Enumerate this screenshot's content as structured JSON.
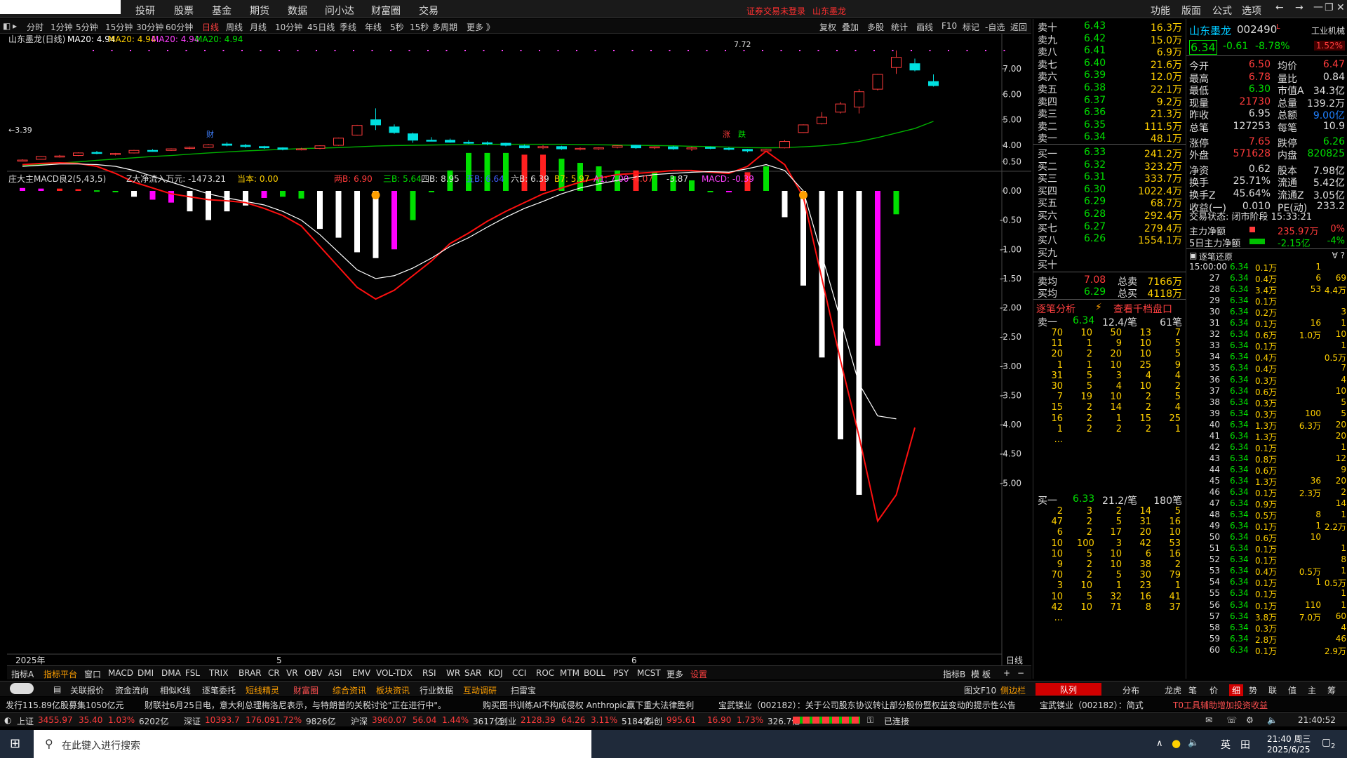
{
  "topmenu": {
    "items": [
      "投研",
      "股票",
      "基金",
      "期货",
      "数据",
      "问小达",
      "财富圈",
      "交易"
    ],
    "notice": "证券交易未登录",
    "stock_name": "山东墨龙",
    "right": [
      "功能",
      "版面",
      "公式",
      "选项"
    ]
  },
  "periods": [
    "分时",
    "1分钟",
    "5分钟",
    "15分钟",
    "30分钟",
    "60分钟",
    "日线",
    "周线",
    "月线",
    "10分钟",
    "45日线",
    "季线",
    "年线",
    "5秒",
    "15秒",
    "多周期",
    "更多 》"
  ],
  "period_active": "日线",
  "tools": [
    "复权",
    "叠加",
    "多股",
    "统计",
    "画线",
    "F10",
    "标记",
    "-自选",
    "返回"
  ],
  "main_chart": {
    "title": "山东墨龙(日线)",
    "ma_labels": [
      "MA20: 4.94",
      "MA20: 4.94",
      "MA20: 4.94",
      "MA20: 4.94"
    ],
    "high_label": "7.72",
    "low_label": "←3.39",
    "axis": [
      "7.00",
      "6.00",
      "5.00",
      "4.00"
    ],
    "badges": [
      "财",
      "涨",
      "跌"
    ]
  },
  "macd": {
    "title": "庄大主MACD良2(5,43,5)",
    "labels": [
      "Z大净流入万元: -1473.21",
      "当本: 0.00",
      "两B: 6.90",
      "三B: 5.64",
      "四B: 8.95",
      "五B: 6.64",
      "六B: 6.39",
      "B7: 5.97",
      "A1: 7.00",
      "-4.07",
      "-3.87",
      "MACD: -0.39"
    ],
    "axis": [
      "0.50",
      "0.00",
      "-0.50",
      "-1.00",
      "-1.50",
      "-2.00",
      "-2.50",
      "-3.00",
      "-3.50",
      "-4.00",
      "-4.50",
      "-5.00"
    ]
  },
  "xaxis": {
    "year": "2025年",
    "months": [
      "5",
      "6"
    ],
    "right": "日线"
  },
  "indicator_tabs": [
    "指标A",
    "指标平台",
    "窗口",
    "MACD",
    "DMI",
    "DMA",
    "FSL",
    "TRIX",
    "BRAR",
    "CR",
    "VR",
    "OBV",
    "ASI",
    "EMV",
    "VOL-TDX",
    "RSI",
    "WR",
    "SAR",
    "KDJ",
    "CCI",
    "ROC",
    "MTM",
    "BOLL",
    "PSY",
    "MCST",
    "更多",
    "设置"
  ],
  "indicator_right": [
    "指标B",
    "模",
    "板",
    "+",
    "−"
  ],
  "bottom_tabs": [
    "关联报价",
    "资金流向",
    "相似K线",
    "逐笔委托",
    "短线精灵",
    "财富圈",
    "综合资讯",
    "板块资讯",
    "行业数据",
    "互动调研",
    "扫雷宝"
  ],
  "bottom_right": [
    "图文F10",
    "侧边栏"
  ],
  "panel_tabs": [
    "队列",
    "分布",
    "龙虎"
  ],
  "right_tabs": [
    "笔",
    "价",
    "细",
    "势",
    "联",
    "值",
    "主",
    "筹"
  ],
  "news": [
    "发行115.89亿股募集1050亿元",
    "财联社6月25日电，意大利总理梅洛尼表示，与特朗普的关税讨论\"正在进行中\"。",
    "购买图书训练AI不构成侵权 Anthropic赢下重大法律胜利",
    "宝武镁业（002182）：关于公司股东协议转让部分股份暨权益变动的提示性公告",
    "宝武镁业（002182）：简式",
    "T0工具辅助增加投资收益"
  ],
  "index_bar": [
    {
      "n": "上证",
      "v": "3455.97",
      "c": "35.40",
      "p": "1.03%",
      "a": "6202亿"
    },
    {
      "n": "深证",
      "v": "10393.7",
      "c": "176.09",
      "p": "1.72%",
      "a": "9826亿"
    },
    {
      "n": "沪深",
      "v": "3960.07",
      "c": "56.04",
      "p": "1.44%",
      "a": "3617亿"
    },
    {
      "n": "创业",
      "v": "2128.39",
      "c": "64.26",
      "p": "3.11%",
      "a": "5184亿"
    },
    {
      "n": "科创",
      "v": "995.61",
      "c": "16.90",
      "p": "1.73%",
      "a": "326.7亿"
    }
  ],
  "connection": "已连接",
  "clock": "21:40:52",
  "orderbook": {
    "asks": [
      [
        "卖十",
        "6.43",
        "16.3万"
      ],
      [
        "卖九",
        "6.42",
        "15.0万"
      ],
      [
        "卖八",
        "6.41",
        "6.9万"
      ],
      [
        "卖七",
        "6.40",
        "21.6万"
      ],
      [
        "卖六",
        "6.39",
        "12.0万"
      ],
      [
        "卖五",
        "6.38",
        "22.1万"
      ],
      [
        "卖四",
        "6.37",
        "9.2万"
      ],
      [
        "卖三",
        "6.36",
        "21.3万"
      ],
      [
        "卖二",
        "6.35",
        "111.5万"
      ],
      [
        "卖一",
        "6.34",
        "48.1万"
      ]
    ],
    "bids": [
      [
        "买一",
        "6.33",
        "241.2万"
      ],
      [
        "买二",
        "6.32",
        "323.2万"
      ],
      [
        "买三",
        "6.31",
        "333.7万"
      ],
      [
        "买四",
        "6.30",
        "1022.4万"
      ],
      [
        "买五",
        "6.29",
        "68.7万"
      ],
      [
        "买六",
        "6.28",
        "292.4万"
      ],
      [
        "买七",
        "6.27",
        "279.4万"
      ],
      [
        "买八",
        "6.26",
        "1554.1万"
      ],
      [
        "买九",
        "",
        ""
      ],
      [
        "买十",
        "",
        ""
      ]
    ],
    "avg_sell": [
      "卖均",
      "7.08",
      "总卖",
      "7166万"
    ],
    "avg_buy": [
      "买均",
      "6.29",
      "总买",
      "4118万"
    ],
    "analysis": "逐笔分析",
    "view_1000": "查看千档盘口",
    "sell1_head": [
      "卖一",
      "6.34",
      "12.4/笔",
      "61笔"
    ],
    "sell1_queue": [
      [
        "70",
        "10",
        "50",
        "13",
        "7"
      ],
      [
        "11",
        "1",
        "9",
        "10",
        "5"
      ],
      [
        "20",
        "2",
        "20",
        "10",
        "5"
      ],
      [
        "1",
        "1",
        "10",
        "25",
        "9"
      ],
      [
        "31",
        "5",
        "3",
        "4",
        "4"
      ],
      [
        "30",
        "5",
        "4",
        "10",
        "2"
      ],
      [
        "7",
        "19",
        "10",
        "2",
        "5"
      ],
      [
        "15",
        "2",
        "14",
        "2",
        "4"
      ],
      [
        "16",
        "2",
        "1",
        "15",
        "25"
      ],
      [
        "1",
        "2",
        "2",
        "2",
        "1"
      ],
      [
        "...",
        "",
        "",
        "",
        ""
      ]
    ],
    "buy1_head": [
      "买一",
      "6.33",
      "21.2/笔",
      "180笔"
    ],
    "buy1_queue": [
      [
        "2",
        "3",
        "2",
        "14",
        "5"
      ],
      [
        "47",
        "2",
        "5",
        "31",
        "16"
      ],
      [
        "6",
        "2",
        "17",
        "20",
        "10"
      ],
      [
        "10",
        "100",
        "3",
        "42",
        "53"
      ],
      [
        "10",
        "5",
        "10",
        "6",
        "16"
      ],
      [
        "9",
        "2",
        "10",
        "38",
        "2"
      ],
      [
        "70",
        "2",
        "5",
        "30",
        "79"
      ],
      [
        "3",
        "10",
        "1",
        "23",
        "1"
      ],
      [
        "10",
        "5",
        "32",
        "16",
        "41"
      ],
      [
        "42",
        "10",
        "71",
        "8",
        "37"
      ],
      [
        "...",
        "",
        "",
        "",
        ""
      ]
    ]
  },
  "quote": {
    "name": "山东墨龙",
    "code": "002490",
    "sector": "工业机械",
    "price": "6.34",
    "chg": "-0.61",
    "pct": "-8.78%",
    "side": "1.52%",
    "rows": [
      [
        "今开",
        "6.50",
        "均价",
        "6.47"
      ],
      [
        "最高",
        "6.78",
        "量比",
        "0.84"
      ],
      [
        "最低",
        "6.30",
        "市值A",
        "34.3亿"
      ],
      [
        "现量",
        "21730",
        "总量",
        "139.2万"
      ],
      [
        "昨收",
        "6.95",
        "总额",
        "9.00亿"
      ],
      [
        "总笔",
        "127253",
        "每笔",
        "10.9"
      ],
      [
        "涨停",
        "7.65",
        "跌停",
        "6.26"
      ],
      [
        "外盘",
        "571628",
        "内盘",
        "820825"
      ],
      [
        "净资",
        "0.62",
        "股本",
        "7.98亿"
      ],
      [
        "换手",
        "25.71%",
        "流通",
        "5.42亿"
      ],
      [
        "换手Z",
        "45.64%",
        "流通Z",
        "3.05亿"
      ],
      [
        "收益(一)",
        "0.010",
        "PE(动)",
        "233.2"
      ]
    ],
    "status": "交易状态: 闭市阶段 15:33:21",
    "flow1": [
      "主力净额",
      "235.97万",
      "0%"
    ],
    "flow2": [
      "5日主力净额",
      "-2.15亿",
      "-4%"
    ],
    "ticks_title": "逐笔还原",
    "ticks": [
      [
        "15:00:00",
        "6.34",
        "0.1万",
        "1",
        ""
      ],
      [
        "27",
        "6.34",
        "0.4万",
        "6",
        "69"
      ],
      [
        "28",
        "6.34",
        "3.4万",
        "53",
        "4.4万"
      ],
      [
        "29",
        "6.34",
        "0.1万",
        "",
        ""
      ],
      [
        "30",
        "6.34",
        "0.2万",
        "",
        "3"
      ],
      [
        "31",
        "6.34",
        "0.1万",
        "16",
        "1"
      ],
      [
        "32",
        "6.34",
        "0.6万",
        "1.0万",
        "10"
      ],
      [
        "33",
        "6.34",
        "0.1万",
        "",
        "1"
      ],
      [
        "34",
        "6.34",
        "0.4万",
        "",
        "0.5万"
      ],
      [
        "35",
        "6.34",
        "0.4万",
        "",
        "7"
      ],
      [
        "36",
        "6.34",
        "0.3万",
        "",
        "4"
      ],
      [
        "37",
        "6.34",
        "0.6万",
        "",
        "10"
      ],
      [
        "38",
        "6.34",
        "0.3万",
        "",
        "5"
      ],
      [
        "39",
        "6.34",
        "0.3万",
        "100",
        "5"
      ],
      [
        "40",
        "6.34",
        "1.3万",
        "6.3万",
        "20"
      ],
      [
        "41",
        "6.34",
        "1.3万",
        "",
        "20"
      ],
      [
        "42",
        "6.34",
        "0.1万",
        "",
        "1"
      ],
      [
        "43",
        "6.34",
        "0.8万",
        "",
        "12"
      ],
      [
        "44",
        "6.34",
        "0.6万",
        "",
        "9"
      ],
      [
        "45",
        "6.34",
        "1.3万",
        "36",
        "20"
      ],
      [
        "46",
        "6.34",
        "0.1万",
        "2.3万",
        "2"
      ],
      [
        "47",
        "6.34",
        "0.9万",
        "",
        "14"
      ],
      [
        "48",
        "6.34",
        "0.5万",
        "8",
        "1"
      ],
      [
        "49",
        "6.34",
        "0.1万",
        "1",
        "2.2万"
      ],
      [
        "50",
        "6.34",
        "0.6万",
        "10",
        ""
      ],
      [
        "51",
        "6.34",
        "0.1万",
        "",
        "1"
      ],
      [
        "52",
        "6.34",
        "0.1万",
        "",
        "8"
      ],
      [
        "53",
        "6.34",
        "0.4万",
        "0.5万",
        "1"
      ],
      [
        "54",
        "6.34",
        "0.1万",
        "1",
        "0.5万"
      ],
      [
        "55",
        "6.34",
        "0.1万",
        "",
        "1"
      ],
      [
        "56",
        "6.34",
        "0.1万",
        "110",
        "1"
      ],
      [
        "57",
        "6.34",
        "3.8万",
        "7.0万",
        "60"
      ],
      [
        "58",
        "6.34",
        "0.3万",
        "",
        "4"
      ],
      [
        "59",
        "6.34",
        "2.8万",
        "",
        "46"
      ],
      [
        "60",
        "6.34",
        "0.1万",
        "",
        "2.9万"
      ]
    ]
  },
  "taskbar": {
    "search": "在此键入进行搜索",
    "time": "21:40 周三",
    "date": "2025/6/25",
    "lang": "英",
    "notif": "2"
  },
  "colors": {
    "up": "#ff3b3b",
    "down": "#00e000",
    "ma": "#00b000",
    "white": "#ffffff",
    "magenta": "#ff00ff"
  },
  "chart_data": {
    "type": "candlestick+bar",
    "ohlc": [
      [
        3.39,
        3.45,
        3.38,
        3.42
      ],
      [
        3.45,
        3.58,
        3.44,
        3.56
      ],
      [
        3.55,
        3.62,
        3.52,
        3.58
      ],
      [
        3.6,
        3.72,
        3.58,
        3.7
      ],
      [
        3.72,
        3.78,
        3.65,
        3.68
      ],
      [
        3.66,
        3.7,
        3.6,
        3.68
      ],
      [
        3.7,
        3.82,
        3.68,
        3.8
      ],
      [
        3.8,
        3.85,
        3.75,
        3.78
      ],
      [
        3.8,
        3.88,
        3.78,
        3.86
      ],
      [
        3.88,
        3.95,
        3.85,
        3.92
      ],
      [
        3.92,
        4.05,
        3.9,
        4.02
      ],
      [
        4.05,
        4.12,
        3.96,
        4.0
      ],
      [
        4.0,
        4.05,
        3.9,
        3.95
      ],
      [
        3.95,
        3.98,
        3.86,
        3.9
      ],
      [
        3.9,
        3.92,
        3.8,
        3.84
      ],
      [
        3.84,
        3.9,
        3.8,
        3.86
      ],
      [
        3.88,
        4.0,
        3.85,
        3.98
      ],
      [
        4.0,
        4.3,
        3.98,
        4.28
      ],
      [
        4.4,
        4.8,
        4.38,
        4.78
      ],
      [
        5.0,
        5.45,
        4.6,
        4.8
      ],
      [
        4.72,
        4.82,
        4.45,
        4.5
      ],
      [
        4.45,
        4.5,
        4.1,
        4.2
      ],
      [
        4.2,
        4.32,
        4.15,
        4.18
      ],
      [
        4.2,
        4.26,
        4.1,
        4.12
      ],
      [
        4.12,
        4.2,
        4.05,
        4.1
      ],
      [
        4.1,
        4.15,
        4.0,
        4.06
      ],
      [
        4.08,
        4.1,
        3.96,
        4.0
      ],
      [
        3.98,
        4.02,
        3.88,
        3.9
      ],
      [
        3.9,
        4.0,
        3.85,
        3.95
      ],
      [
        3.95,
        3.98,
        3.82,
        3.86
      ],
      [
        3.86,
        3.92,
        3.8,
        3.88
      ],
      [
        3.86,
        3.92,
        3.82,
        3.9
      ],
      [
        3.92,
        4.0,
        3.88,
        3.98
      ],
      [
        4.0,
        4.02,
        3.86,
        3.9
      ],
      [
        3.9,
        3.96,
        3.85,
        3.94
      ],
      [
        3.94,
        3.98,
        3.82,
        3.86
      ],
      [
        3.86,
        3.95,
        3.78,
        3.9
      ],
      [
        3.92,
        3.95,
        3.85,
        3.88
      ],
      [
        3.88,
        3.92,
        3.8,
        3.84
      ],
      [
        3.84,
        3.86,
        3.72,
        3.78
      ],
      [
        3.78,
        3.86,
        3.76,
        3.84
      ],
      [
        3.9,
        4.2,
        3.88,
        4.15
      ],
      [
        4.5,
        4.82,
        4.48,
        4.8
      ],
      [
        4.85,
        5.3,
        4.82,
        5.1
      ],
      [
        5.3,
        5.7,
        5.25,
        5.62
      ],
      [
        5.5,
        6.2,
        5.25,
        6.1
      ],
      [
        6.2,
        6.8,
        6.15,
        6.78
      ],
      [
        7.05,
        7.72,
        6.8,
        7.45
      ],
      [
        7.2,
        7.4,
        6.9,
        6.95
      ],
      [
        6.5,
        6.78,
        6.3,
        6.34
      ]
    ],
    "ma20": [
      3.2,
      3.25,
      3.3,
      3.35,
      3.41,
      3.46,
      3.51,
      3.56,
      3.6,
      3.65,
      3.7,
      3.74,
      3.78,
      3.81,
      3.84,
      3.87,
      3.89,
      3.91,
      3.94,
      3.97,
      3.99,
      4.0,
      4.01,
      4.02,
      4.03,
      4.04,
      4.04,
      4.04,
      4.04,
      4.04,
      4.03,
      4.02,
      4.01,
      4.0,
      3.99,
      3.98,
      3.96,
      3.95,
      3.93,
      3.91,
      3.9,
      3.91,
      3.94,
      3.98,
      4.05,
      4.15,
      4.3,
      4.48,
      4.66,
      4.94
    ],
    "macd_bars": [
      0.05,
      0.04,
      0.04,
      0.03,
      0.01,
      0.0,
      -0.1,
      -0.15,
      -0.2,
      -0.35,
      -0.5,
      -0.35,
      -0.25,
      -0.12,
      -0.1,
      -0.13,
      -0.65,
      -0.8,
      -1.05,
      -1.15,
      -1.0,
      -0.5,
      0.0,
      0.35,
      0.65,
      0.65,
      0.65,
      0.62,
      0.62,
      0.55,
      0.48,
      0.42,
      0.35,
      0.35,
      0.32,
      0.25,
      0.18,
      0.0,
      0.0,
      0.32,
      0.42,
      -0.45,
      -1.62,
      -2.85,
      -4.25,
      -5.2,
      -2.65,
      -0.4
    ],
    "macd_colors": [
      "m",
      "m",
      "r",
      "r",
      "g",
      "g",
      "w",
      "m",
      "m",
      "w",
      "w",
      "w",
      "w",
      "m",
      "g",
      "g",
      "w",
      "w",
      "w",
      "w",
      "m",
      "g",
      "g",
      "g",
      "g",
      "g",
      "g",
      "r",
      "r",
      "g",
      "g",
      "g",
      "g",
      "r",
      "g",
      "g",
      "g",
      "g",
      "m",
      "r",
      "g",
      "w",
      "w",
      "w",
      "w",
      "w",
      "m",
      "g"
    ],
    "dif": [
      0.45,
      0.47,
      0.48,
      0.47,
      0.42,
      0.3,
      0.15,
      0.05,
      -0.05,
      -0.1,
      -0.15,
      -0.17,
      -0.2,
      -0.3,
      -0.42,
      -0.6,
      -0.95,
      -1.3,
      -1.65,
      -1.85,
      -1.7,
      -1.45,
      -1.2,
      -0.9,
      -0.72,
      -0.52,
      -0.35,
      -0.2,
      -0.05,
      0.05,
      0.15,
      0.22,
      0.28,
      0.3,
      0.32,
      0.35,
      0.35,
      0.32,
      0.3,
      0.42,
      0.68,
      0.45,
      -0.1,
      -1.5,
      -2.9,
      -4.2,
      -5.65,
      -5.2,
      -4.05
    ],
    "dea": [
      0.42,
      0.44,
      0.46,
      0.46,
      0.45,
      0.42,
      0.35,
      0.25,
      0.15,
      0.05,
      -0.05,
      -0.12,
      -0.18,
      -0.24,
      -0.35,
      -0.5,
      -0.75,
      -1.05,
      -1.35,
      -1.5,
      -1.45,
      -1.32,
      -1.15,
      -0.95,
      -0.8,
      -0.62,
      -0.45,
      -0.3,
      -0.18,
      -0.05,
      0.05,
      0.12,
      0.18,
      0.24,
      0.28,
      0.3,
      0.32,
      0.33,
      0.32,
      0.38,
      0.45,
      0.35,
      0.0,
      -1.1,
      -2.2,
      -3.3,
      -3.85,
      -3.9
    ]
  }
}
